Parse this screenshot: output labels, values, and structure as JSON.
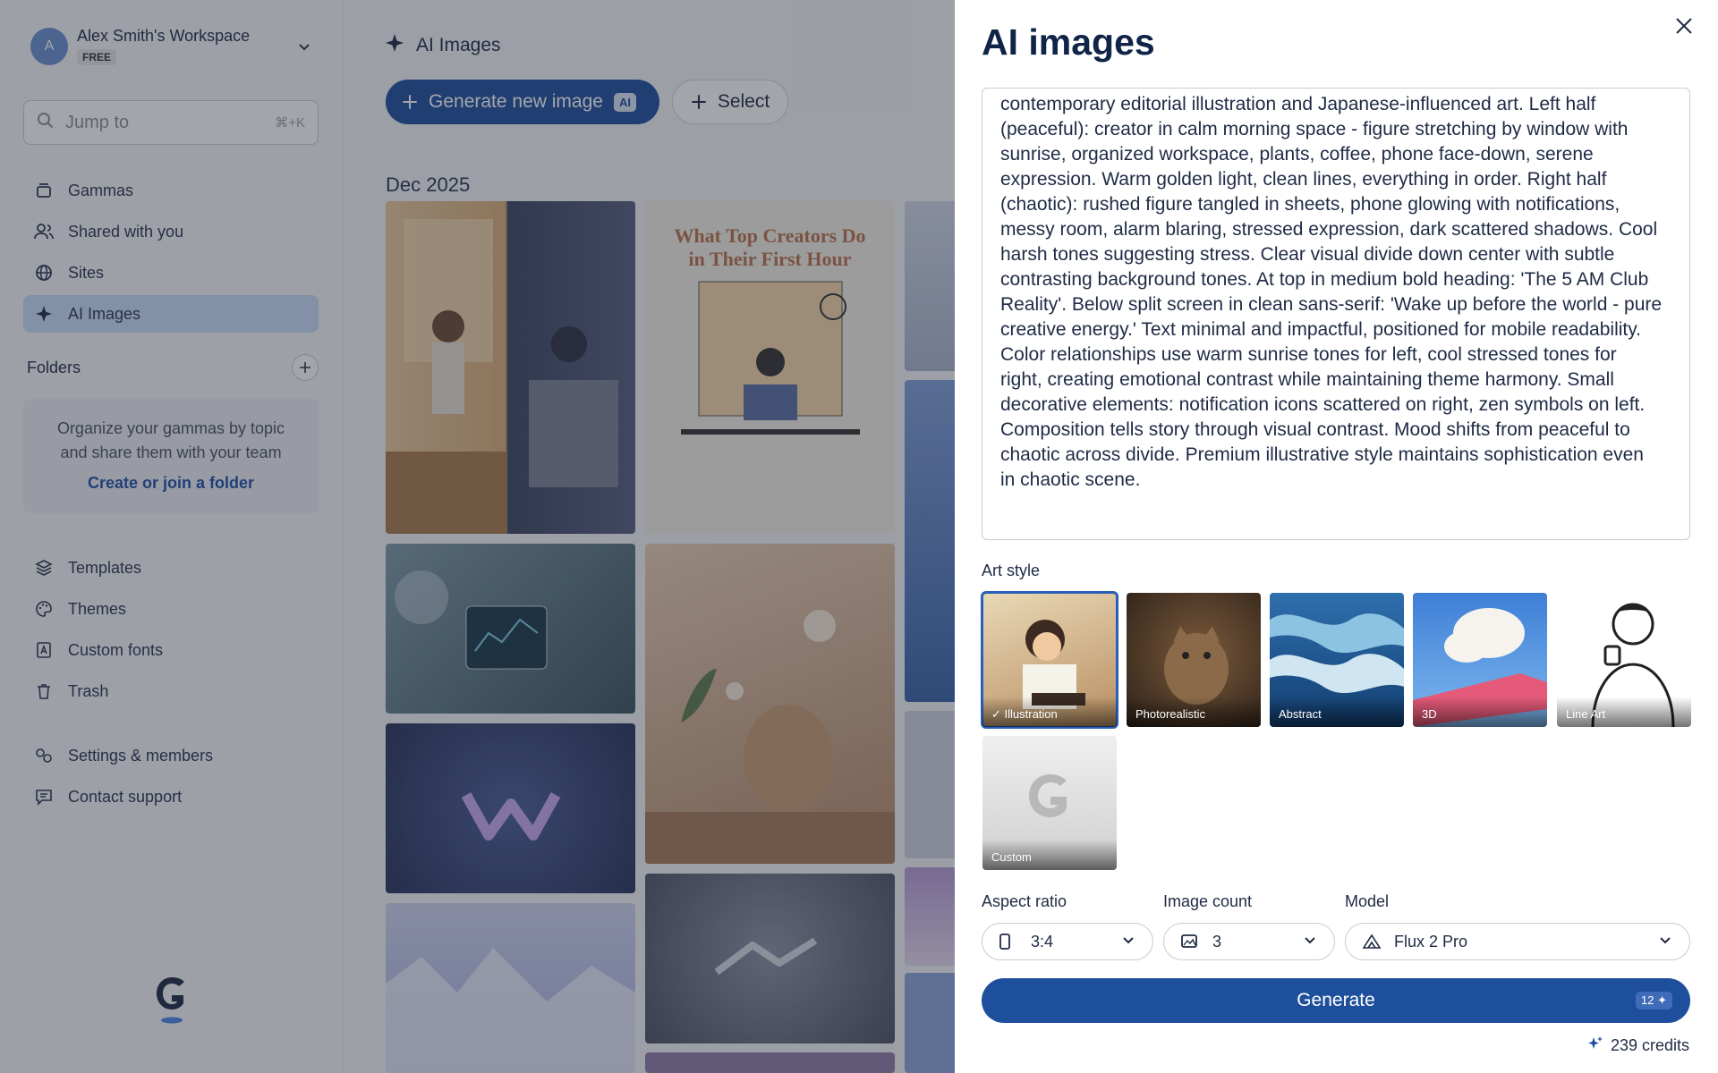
{
  "workspace": {
    "avatar": "A",
    "name": "Alex Smith's Workspace",
    "plan": "FREE"
  },
  "search": {
    "placeholder": "Jump to",
    "shortcut": "⌘+K"
  },
  "nav_main": [
    {
      "label": "Gammas",
      "icon": "stack-icon"
    },
    {
      "label": "Shared with you",
      "icon": "users-icon"
    },
    {
      "label": "Sites",
      "icon": "globe-icon"
    },
    {
      "label": "AI Images",
      "icon": "sparkle-icon",
      "active": true
    }
  ],
  "folders": {
    "title": "Folders",
    "empty_text_line1": "Organize your gammas by topic",
    "empty_text_line2": "and share them with your team",
    "link": "Create or join a folder"
  },
  "nav_secondary": [
    {
      "label": "Templates",
      "icon": "layers-icon"
    },
    {
      "label": "Themes",
      "icon": "palette-icon"
    },
    {
      "label": "Custom fonts",
      "icon": "font-icon"
    },
    {
      "label": "Trash",
      "icon": "trash-icon"
    }
  ],
  "nav_bottom": [
    {
      "label": "Settings & members",
      "icon": "settings-icon"
    },
    {
      "label": "Contact support",
      "icon": "chat-icon"
    }
  ],
  "main": {
    "title": "AI Images",
    "generate_button": "Generate new image",
    "ai_badge": "AI",
    "select_button": "Select",
    "month": "Dec 2025",
    "poster_title_line1": "What Top Creators Do",
    "poster_title_line2": "in Their First Hour"
  },
  "panel": {
    "title": "AI images",
    "prompt_lines": [
      "contemporary editorial illustration and Japanese-influenced art. Left half",
      "(peaceful): creator in calm morning space - figure stretching by window with",
      "sunrise, organized workspace, plants, coffee, phone face-down, serene",
      "expression. Warm golden light, clean lines, everything in order. Right half",
      "(chaotic): rushed figure tangled in sheets, phone glowing with notifications,",
      "messy room, alarm blaring, stressed expression, dark scattered shadows. Cool",
      "harsh tones suggesting stress. Clear visual divide down center with subtle",
      "contrasting background tones. At top in medium bold heading: 'The 5 AM Club",
      "Reality'. Below split screen in clean sans-serif: 'Wake up before the world - pure",
      "creative energy.' Text minimal and impactful, positioned for mobile readability.",
      "Color relationships use warm sunrise tones for left, cool stressed tones for",
      "right, creating emotional contrast while maintaining theme harmony. Small",
      "decorative elements: notification icons scattered on right, zen symbols on left.",
      "Composition tells story through visual contrast. Mood shifts from peaceful to",
      "chaotic across divide. Premium illustrative style maintains sophistication even",
      "in chaotic scene."
    ],
    "art_style_label": "Art style",
    "styles": [
      {
        "label": "Illustration",
        "selected": true
      },
      {
        "label": "Photorealistic",
        "selected": false
      },
      {
        "label": "Abstract",
        "selected": false
      },
      {
        "label": "3D",
        "selected": false
      },
      {
        "label": "Line Art",
        "selected": false
      },
      {
        "label": "Custom",
        "selected": false
      }
    ],
    "aspect_ratio": {
      "label": "Aspect ratio",
      "value": "3:4"
    },
    "image_count": {
      "label": "Image count",
      "value": "3"
    },
    "model": {
      "label": "Model",
      "value": "Flux 2 Pro"
    },
    "generate_button": "Generate",
    "generate_cost": "12",
    "credits": "239 credits"
  },
  "colors": {
    "accent": "#1e4f9c",
    "active_nav": "#c8dcf7",
    "title": "#0f2446"
  }
}
